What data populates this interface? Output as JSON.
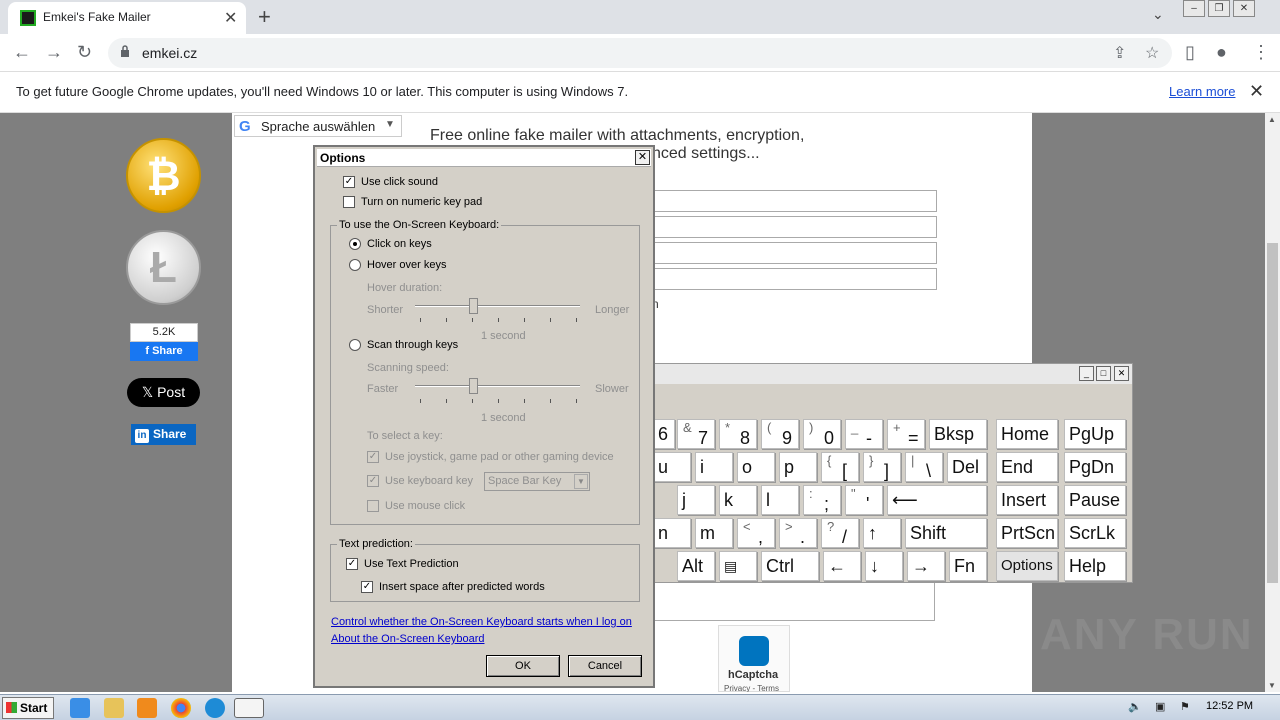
{
  "browser": {
    "tab_title": "Emkei's Fake Mailer",
    "url": "emkei.cz",
    "infobar_text": "To get future Google Chrome updates, you'll need Windows 10 or later. This computer is using Windows 7.",
    "infobar_link": "Learn more"
  },
  "page": {
    "translate_label": "Sprache auswählen",
    "headline_line1": "Free online fake mailer with attachments, encryption,",
    "headline_line2": "nced settings...",
    "frag_m": "n",
    "fb_count": "5.2K",
    "fb_share": "Share",
    "x_post": "Post",
    "li_share": "Share",
    "hcaptcha_label": "hCaptcha",
    "hcaptcha_small": "Privacy - Terms"
  },
  "osk": {
    "keys": {
      "k6": "6",
      "k7_sup": "&",
      "k7": "7",
      "k8_sup": "*",
      "k8": "8",
      "k9_sup": "(",
      "k9": "9",
      "k0_sup": ")",
      "k0": "0",
      "kminus_sup": "_",
      "kminus": "-",
      "kplus_sup": "+",
      "kplus": "=",
      "bksp": "Bksp",
      "home": "Home",
      "pgup": "PgUp",
      "u": "u",
      "i": "i",
      "o": "o",
      "p": "p",
      "lbr_sup": "{",
      "lbr": "[",
      "rbr_sup": "}",
      "rbr": "]",
      "pipe_sup": "|",
      "bslash": "\\",
      "del": "Del",
      "end": "End",
      "pgdn": "PgDn",
      "j": "j",
      "k": "k",
      "l": "l",
      "colon_sup": ":",
      "semi": ";",
      "quote_sup": "\"",
      "apos": "'",
      "enter": "⟵",
      "insert": "Insert",
      "pause": "Pause",
      "n": "n",
      "m": "m",
      "lt_sup": "<",
      "comma": ",",
      "gt_sup": ">",
      "dot": ".",
      "q_sup": "?",
      "slash": "/",
      "up": "↑",
      "shift": "Shift",
      "prtscn": "PrtScn",
      "scrlk": "ScrLk",
      "alt": "Alt",
      "menu": "▤",
      "ctrl": "Ctrl",
      "left": "←",
      "down": "↓",
      "right": "→",
      "fn": "Fn",
      "options": "Options",
      "help": "Help"
    }
  },
  "dialog": {
    "title": "Options",
    "use_click_sound": "Use click sound",
    "numeric_keypad": "Turn on numeric key pad",
    "group1_title": "To use the On-Screen Keyboard:",
    "click_on_keys": "Click on keys",
    "hover_over_keys": "Hover over keys",
    "hover_duration": "Hover duration:",
    "shorter": "Shorter",
    "longer": "Longer",
    "one_second_a": "1 second",
    "scan_through_keys": "Scan through keys",
    "scanning_speed": "Scanning speed:",
    "faster": "Faster",
    "slower": "Slower",
    "one_second_b": "1 second",
    "to_select_key": "To select a key:",
    "use_joystick": "Use joystick, game pad or other gaming device",
    "use_keyboard_key": "Use keyboard key",
    "keyboard_key_value": "Space Bar Key",
    "use_mouse_click": "Use mouse click",
    "group2_title": "Text prediction:",
    "use_text_prediction": "Use Text Prediction",
    "insert_space": "Insert space after predicted words",
    "link1": "Control whether the On-Screen Keyboard starts when I log on",
    "link2": "About the On-Screen Keyboard",
    "ok": "OK",
    "cancel": "Cancel"
  },
  "watermark": "ANY RUN",
  "taskbar": {
    "start": "Start",
    "time": "12:52 PM"
  },
  "colors": {
    "dialog_bg": "#d4d0c8",
    "link": "#0000cc",
    "fb": "#1877f2",
    "linkedin": "#0a66c2"
  }
}
